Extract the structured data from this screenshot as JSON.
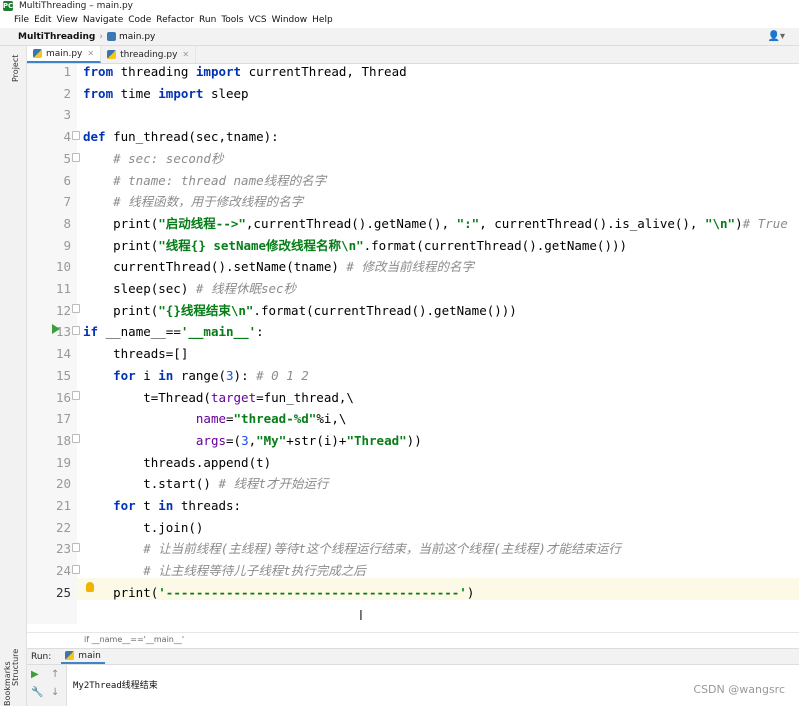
{
  "window": {
    "title": "MultiThreading – main.py"
  },
  "menu": [
    "File",
    "Edit",
    "View",
    "Navigate",
    "Code",
    "Refactor",
    "Run",
    "Tools",
    "VCS",
    "Window",
    "Help"
  ],
  "navbar": {
    "project": "MultiThreading",
    "file": "main.py"
  },
  "side_tabs": {
    "project": "Project",
    "structure": "Structure",
    "bookmarks": "Bookmarks"
  },
  "tabs": [
    {
      "label": "main.py",
      "active": true
    },
    {
      "label": "threading.py",
      "active": false
    }
  ],
  "editor": {
    "line_numbers": [
      "1",
      "2",
      "3",
      "4",
      "5",
      "6",
      "7",
      "8",
      "9",
      "10",
      "11",
      "12",
      "13",
      "14",
      "15",
      "16",
      "17",
      "18",
      "19",
      "20",
      "21",
      "22",
      "23",
      "24",
      "25"
    ],
    "current_line": "25",
    "lines": [
      [
        [
          "kw",
          "from"
        ],
        [
          "fn",
          " threading "
        ],
        [
          "kw",
          "import"
        ],
        [
          "fn",
          " currentThread, Thread"
        ]
      ],
      [
        [
          "kw",
          "from"
        ],
        [
          "fn",
          " time "
        ],
        [
          "kw",
          "import"
        ],
        [
          "fn",
          " sleep"
        ]
      ],
      [],
      [
        [
          "kw",
          "def"
        ],
        [
          "fn",
          " fun_thread(sec,tname):"
        ]
      ],
      [
        [
          "fn",
          "    "
        ],
        [
          "cm",
          "# sec: second秒"
        ]
      ],
      [
        [
          "fn",
          "    "
        ],
        [
          "cm",
          "# tname: thread name线程的名字"
        ]
      ],
      [
        [
          "fn",
          "    "
        ],
        [
          "cm",
          "# 线程函数，用于修改线程的名字"
        ]
      ],
      [
        [
          "fn",
          "    print("
        ],
        [
          "st",
          "\"启动线程-->\""
        ],
        [
          "fn",
          ",currentThread().getName(), "
        ],
        [
          "st",
          "\":\""
        ],
        [
          "fn",
          ", currentThread().is_alive(), "
        ],
        [
          "st",
          "\"\\n\""
        ],
        [
          "fn",
          ")"
        ],
        [
          "cm",
          "# True"
        ]
      ],
      [
        [
          "fn",
          "    print("
        ],
        [
          "st",
          "\"线程{} setName修改线程名称\\n\""
        ],
        [
          "fn",
          ".format(currentThread().getName()))"
        ]
      ],
      [
        [
          "fn",
          "    currentThread().setName(tname) "
        ],
        [
          "cm",
          "# 修改当前线程的名字"
        ]
      ],
      [
        [
          "fn",
          "    sleep(sec) "
        ],
        [
          "cm",
          "# 线程休眠sec秒"
        ]
      ],
      [
        [
          "fn",
          "    print("
        ],
        [
          "st",
          "\"{}线程结束\\n\""
        ],
        [
          "fn",
          ".format(currentThread().getName()))"
        ]
      ],
      [
        [
          "kw",
          "if"
        ],
        [
          "fn",
          " __name__=="
        ],
        [
          "st",
          "'__main__'"
        ],
        [
          "fn",
          ":"
        ]
      ],
      [
        [
          "fn",
          "    threads=[]"
        ]
      ],
      [
        [
          "fn",
          "    "
        ],
        [
          "kw",
          "for"
        ],
        [
          "fn",
          " i "
        ],
        [
          "kw",
          "in"
        ],
        [
          "fn",
          " range("
        ],
        [
          "nu",
          "3"
        ],
        [
          "fn",
          "): "
        ],
        [
          "cm",
          "# 0 1 2"
        ]
      ],
      [
        [
          "fn",
          "        t=Thread("
        ],
        [
          "pa",
          "target"
        ],
        [
          "fn",
          "=fun_thread,\\"
        ]
      ],
      [
        [
          "fn",
          "               "
        ],
        [
          "pa",
          "name"
        ],
        [
          "fn",
          "="
        ],
        [
          "st",
          "\"thread-%d\""
        ],
        [
          "fn",
          "%i,\\"
        ]
      ],
      [
        [
          "fn",
          "               "
        ],
        [
          "pa",
          "args"
        ],
        [
          "fn",
          "=("
        ],
        [
          "nu",
          "3"
        ],
        [
          "fn",
          ","
        ],
        [
          "st",
          "\"My\""
        ],
        [
          "fn",
          "+str(i)+"
        ],
        [
          "st",
          "\"Thread\""
        ],
        [
          "fn",
          "))"
        ]
      ],
      [
        [
          "fn",
          "        threads.append(t)"
        ]
      ],
      [
        [
          "fn",
          "        t.start() "
        ],
        [
          "cm",
          "# 线程t才开始运行"
        ]
      ],
      [
        [
          "fn",
          "    "
        ],
        [
          "kw",
          "for"
        ],
        [
          "fn",
          " t "
        ],
        [
          "kw",
          "in"
        ],
        [
          "fn",
          " threads:"
        ]
      ],
      [
        [
          "fn",
          "        t.join()"
        ]
      ],
      [
        [
          "fn",
          "        "
        ],
        [
          "cm",
          "# 让当前线程(主线程)等待t这个线程运行结束，当前这个线程(主线程)才能结束运行"
        ]
      ],
      [
        [
          "fn",
          "        "
        ],
        [
          "cm",
          "# 让主线程等待儿子线程t执行完成之后"
        ]
      ],
      [
        [
          "fn",
          "    print("
        ],
        [
          "st",
          "'---------------------------------------'"
        ],
        [
          "fn",
          ")"
        ]
      ]
    ]
  },
  "bottom_breadcrumb": "if __name__=='__main__'",
  "run_panel": {
    "label": "Run:",
    "tab": "main",
    "output": "My2Thread线程结束"
  },
  "watermark": "CSDN @wangsrc"
}
